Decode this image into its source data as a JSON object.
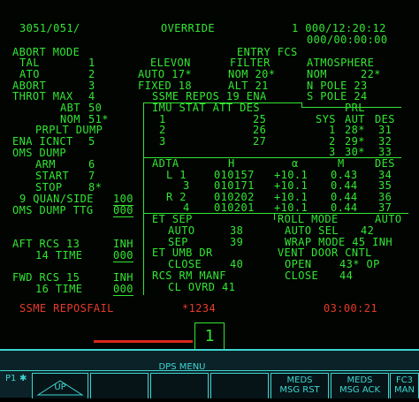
{
  "header": {
    "ops": "3051/051/",
    "mode": "OVERRIDE",
    "time1": "1 000/12:20:12",
    "time2": "000/00:00:00"
  },
  "abort": {
    "title": "ABORT MODE",
    "rows": [
      {
        "label": "TAL",
        "value": "1"
      },
      {
        "label": "ATO",
        "value": "2"
      },
      {
        "label": "ABORT",
        "value": "3"
      },
      {
        "label": "THROT MAX",
        "value": "4"
      },
      {
        "label": "ABT",
        "value": "50"
      },
      {
        "label": "NOM",
        "value": "51*"
      }
    ],
    "prplt_dump": "PRPLT DUMP",
    "ena_icnct": "ENA ICNCT",
    "ena_icnct_val": "5",
    "oms_dump": "OMS DUMP",
    "arm": "ARM",
    "arm_val": "6",
    "start": "START",
    "start_val": "7",
    "stop": "STOP",
    "stop_val": "8*",
    "quan_side": "9 QUAN/SIDE",
    "quan_side_val": "100",
    "oms_ttg": "OMS DUMP TTG",
    "oms_ttg_val": "000"
  },
  "rcs": {
    "aft": "AFT RCS 13",
    "aft_val": "INH",
    "aft_time": "14 TIME",
    "aft_time_val": "000",
    "fwd": "FWD RCS 15",
    "fwd_val": "INH",
    "fwd_time": "16 TIME",
    "fwd_time_val": "000"
  },
  "entry_fcs": {
    "title": "ENTRY FCS",
    "elevon": "ELEVON",
    "filter": "FILTER",
    "atmosphere": "ATMOSPHERE",
    "auto": "AUTO 17*",
    "fixed": "FIXED 18",
    "nom": "NOM 20*",
    "alt": "ALT 21",
    "atm_nom": "NOM",
    "atm_nom_val": "22*",
    "n_pole": "N POLE 23",
    "s_pole": "S POLE 24",
    "ssme_repos": "SSME REPOS 19 ENA"
  },
  "imu": {
    "header": "IMU STAT ATT DES",
    "rows": [
      {
        "n": "1",
        "des": "25"
      },
      {
        "n": "2",
        "des": "26"
      },
      {
        "n": "3",
        "des": "27"
      }
    ]
  },
  "prl": {
    "title": "PRL",
    "cols": [
      "SYS",
      "AUT",
      "DES"
    ],
    "rows": [
      {
        "sys": "1",
        "aut": "28*",
        "des": "31"
      },
      {
        "sys": "2",
        "aut": "29*",
        "des": "32"
      },
      {
        "sys": "3",
        "aut": "30*",
        "des": "33"
      }
    ]
  },
  "adta": {
    "cols": [
      "ADTA",
      "H",
      "α",
      "M",
      "DES"
    ],
    "rows": [
      {
        "id": "L 1",
        "h": "010157",
        "alpha": "+10.1",
        "m": "0.43",
        "des": "34"
      },
      {
        "id": "3",
        "h": "010171",
        "alpha": "+10.1",
        "m": "0.44",
        "des": "35"
      },
      {
        "id": "R 2",
        "h": "010202",
        "alpha": "+10.1",
        "m": "0.44",
        "des": "36"
      },
      {
        "id": "4",
        "h": "010201",
        "alpha": "+10.1",
        "m": "0.44",
        "des": "37"
      }
    ]
  },
  "et_sep": {
    "title": "ET SEP",
    "auto": "AUTO",
    "auto_val": "38",
    "sep": "SEP",
    "sep_val": "39"
  },
  "et_umb": {
    "title": "ET UMB DR",
    "close": "CLOSE",
    "close_val": "40"
  },
  "rcs_rm": {
    "title": "RCS RM MANF",
    "cl_ovrd": "CL OVRD 41"
  },
  "roll": {
    "title": "ROLL MODE",
    "mode": "AUTO",
    "auto_sel": "AUTO SEL",
    "auto_sel_val": "42",
    "wrap": "WRAP MODE 45 INH"
  },
  "vent": {
    "title": "VENT DOOR CNTL",
    "open": "OPEN",
    "open_val": "43* OP",
    "close": "CLOSE",
    "close_val": "44"
  },
  "status": {
    "fault": "SSME REPOSFAIL",
    "code": "*1234",
    "time": "03:00:21"
  },
  "page_indicator": "1",
  "bezel": {
    "p1": "P1",
    "menu_title": "DPS MENU",
    "up": "UP",
    "keys": [
      "MEDS\nMSG RST",
      "MEDS\nMSG ACK",
      "FC3\nMAN"
    ]
  },
  "colors": {
    "phosphor": "#33e633",
    "alert": "#e63a2a",
    "bezel": "#3fd6d0"
  }
}
